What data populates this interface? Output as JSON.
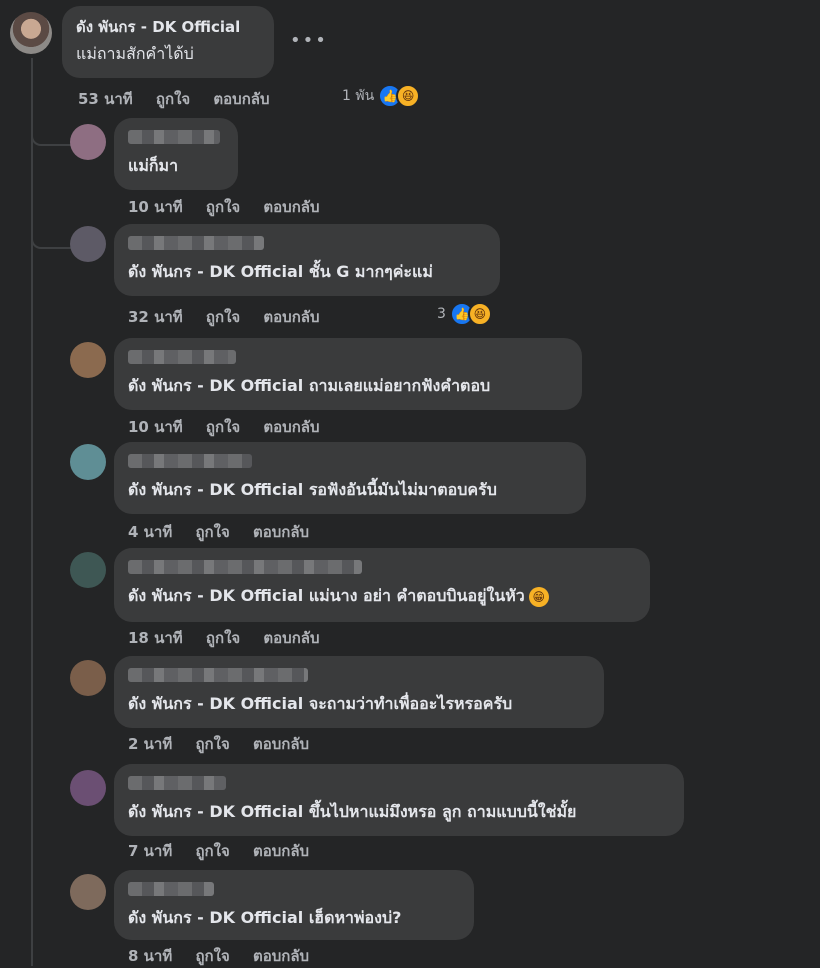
{
  "main_comment": {
    "author": "ดัง พันกร - DK Official",
    "text": "แม่ถามสักคำได้บ่",
    "time": "53 นาที",
    "like_label": "ถูกใจ",
    "reply_label": "ตอบกลับ",
    "reaction_count": "1 พัน",
    "more_icon": "more-horizontal-icon"
  },
  "replies": [
    {
      "text_tag": "",
      "text": "แม่ก็มา",
      "time": "10 นาที",
      "like_label": "ถูกใจ",
      "reply_label": "ตอบกลับ",
      "reaction_count": ""
    },
    {
      "text_tag": "ดัง พันกร - DK Official",
      "text": " ชั้น G มากๆค่ะแม่",
      "time": "32 นาที",
      "like_label": "ถูกใจ",
      "reply_label": "ตอบกลับ",
      "reaction_count": "3"
    },
    {
      "text_tag": "ดัง พันกร - DK Official",
      "text": " ถามเลยแม่อยากฟังคำตอบ",
      "time": "10 นาที",
      "like_label": "ถูกใจ",
      "reply_label": "ตอบกลับ",
      "reaction_count": ""
    },
    {
      "text_tag": "ดัง พันกร - DK Official",
      "text": " รอฟังอันนี้มันไม่มาตอบครับ",
      "time": "4 นาที",
      "like_label": "ถูกใจ",
      "reply_label": "ตอบกลับ",
      "reaction_count": ""
    },
    {
      "text_tag": "ดัง พันกร - DK Official",
      "text": " แม่นาง อย่า คำตอบบินอยู่ในหัว",
      "time": "18 นาที",
      "like_label": "ถูกใจ",
      "reply_label": "ตอบกลับ",
      "reaction_count": "",
      "emoji": "😁"
    },
    {
      "text_tag": "ดัง พันกร - DK Official",
      "text": " จะถามว่าทำเพื่ออะไรหรอครับ",
      "time": "2 นาที",
      "like_label": "ถูกใจ",
      "reply_label": "ตอบกลับ",
      "reaction_count": ""
    },
    {
      "text_tag": "ดัง พันกร - DK Official",
      "text": " ขึ้นไปหาแม่มึงหรอ ลูก ถามแบบนี้ใช่มั้ย",
      "time": "7 นาที",
      "like_label": "ถูกใจ",
      "reply_label": "ตอบกลับ",
      "reaction_count": ""
    },
    {
      "text_tag": "ดัง พันกร - DK Official",
      "text": " เฮ็ดหาพ่องบ่?",
      "time": "8 นาที",
      "like_label": "ถูกใจ",
      "reply_label": "ตอบกลับ",
      "reaction_count": ""
    }
  ],
  "colors": {
    "background": "#242526",
    "bubble": "#3a3b3c",
    "text": "#e4e6eb",
    "meta": "#b0b3b8",
    "like": "#1877f2",
    "haha": "#f7b125"
  }
}
